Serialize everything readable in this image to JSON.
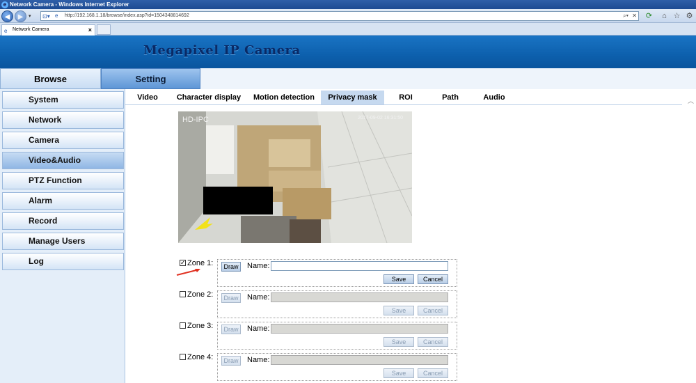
{
  "window": {
    "title": "Network Camera - Windows Internet Explorer"
  },
  "browser": {
    "url": "http://192.168.1.18/browse/index.asp?id=1504348814692",
    "tab_label": "Network Camera",
    "icons": [
      "back-icon",
      "forward-icon",
      "refresh-icon",
      "home-icon",
      "star-icon",
      "gear-icon"
    ]
  },
  "header": {
    "brand": "Megapixel IP Camera"
  },
  "main_tabs": {
    "browse": "Browse",
    "setting": "Setting"
  },
  "sidebar": {
    "items": [
      {
        "label": "System"
      },
      {
        "label": "Network"
      },
      {
        "label": "Camera"
      },
      {
        "label": "Video&Audio",
        "active": true
      },
      {
        "label": "PTZ Function"
      },
      {
        "label": "Alarm"
      },
      {
        "label": "Record"
      },
      {
        "label": "Manage Users"
      },
      {
        "label": "Log"
      }
    ]
  },
  "sub_tabs": {
    "items": [
      "Video",
      "Character display",
      "Motion detection",
      "Privacy mask",
      "ROI",
      "Path",
      "Audio"
    ],
    "active": "Privacy mask"
  },
  "camera": {
    "osd_left": "HD-IPC",
    "osd_right": "2017-09-02  16:31:50"
  },
  "zones": [
    {
      "label": "Zone 1:",
      "checked": true,
      "draw": "Draw",
      "name_label": "Name:",
      "name_value": "",
      "save": "Save",
      "cancel": "Cancel"
    },
    {
      "label": "Zone 2:",
      "checked": false,
      "draw": "Draw",
      "name_label": "Name:",
      "name_value": "",
      "save": "Save",
      "cancel": "Cancel"
    },
    {
      "label": "Zone 3:",
      "checked": false,
      "draw": "Draw",
      "name_label": "Name:",
      "name_value": "",
      "save": "Save",
      "cancel": "Cancel"
    },
    {
      "label": "Zone 4:",
      "checked": false,
      "draw": "Draw",
      "name_label": "Name:",
      "name_value": "",
      "save": "Save",
      "cancel": "Cancel"
    }
  ],
  "colors": {
    "header_blue": "#0d60ad",
    "brand_text": "#0a2a66",
    "mask_black": "#000000",
    "arrow_yellow": "#f2e21a",
    "annotation_red": "#e03020"
  }
}
